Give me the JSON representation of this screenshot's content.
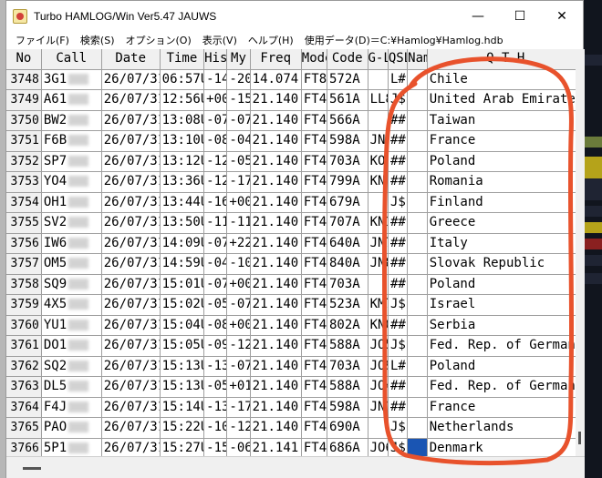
{
  "window": {
    "title": "Turbo HAMLOG/Win Ver5.47 JAUWS",
    "minimize_glyph": "—",
    "maximize_glyph": "☐",
    "close_glyph": "✕"
  },
  "menu": [
    "ファイル(F)",
    "検索(S)",
    "オプション(O)",
    "表示(V)",
    "ヘルプ(H)",
    "使用データ(D)＝C:¥Hamlog¥Hamlog.hdb"
  ],
  "columns": [
    "No",
    "Call",
    "Date",
    "Time",
    "His",
    "My",
    "Freq",
    "Mode",
    "Code",
    "G-L",
    "QSL",
    "Nam",
    "Q T H"
  ],
  "rows": [
    {
      "no": "3748",
      "call": "3G1",
      "date": "26/07/31",
      "time": "06:57U",
      "his": "-14",
      "my": "-20",
      "freq": "14.074",
      "mode": "FT8",
      "code": "572A",
      "gl": "",
      "qsl": "L#",
      "qth": "Chile"
    },
    {
      "no": "3749",
      "call": "A61",
      "date": "26/07/31",
      "time": "12:56U",
      "his": "+00",
      "my": "-15",
      "freq": "21.140",
      "mode": "FT4",
      "code": "561A",
      "gl": "LL8",
      "qsl": "J$",
      "qth": "United Arab Emirates"
    },
    {
      "no": "3750",
      "call": "BW2",
      "date": "26/07/31",
      "time": "13:08U",
      "his": "-07",
      "my": "-07",
      "freq": "21.140",
      "mode": "FT4",
      "code": "566A",
      "gl": "",
      "qsl": "##",
      "qth": "Taiwan"
    },
    {
      "no": "3751",
      "call": "F6B",
      "date": "26/07/31",
      "time": "13:10U",
      "his": "-08",
      "my": "-04",
      "freq": "21.140",
      "mode": "FT4",
      "code": "598A",
      "gl": "JN1",
      "qsl": "##",
      "qth": "France"
    },
    {
      "no": "3752",
      "call": "SP7",
      "date": "26/07/31",
      "time": "13:12U",
      "his": "-12",
      "my": "-05",
      "freq": "21.140",
      "mode": "FT4",
      "code": "703A",
      "gl": "KO0",
      "qsl": "##",
      "qth": "Poland"
    },
    {
      "no": "3753",
      "call": "YO4",
      "date": "26/07/31",
      "time": "13:36U",
      "his": "-12",
      "my": "-17",
      "freq": "21.140",
      "mode": "FT4",
      "code": "799A",
      "gl": "KN4",
      "qsl": "##",
      "qth": "Romania"
    },
    {
      "no": "3754",
      "call": "OH1",
      "date": "26/07/31",
      "time": "13:44U",
      "his": "-16",
      "my": "+00",
      "freq": "21.140",
      "mode": "FT4",
      "code": "679A",
      "gl": "",
      "qsl": "J$",
      "qth": "Finland"
    },
    {
      "no": "3755",
      "call": "SV2",
      "date": "26/07/31",
      "time": "13:50U",
      "his": "-11",
      "my": "-11",
      "freq": "21.140",
      "mode": "FT4",
      "code": "707A",
      "gl": "KN1",
      "qsl": "##",
      "qth": "Greece"
    },
    {
      "no": "3756",
      "call": "IW6",
      "date": "26/07/31",
      "time": "14:09U",
      "his": "-07",
      "my": "+22",
      "freq": "21.140",
      "mode": "FT4",
      "code": "640A",
      "gl": "JN7",
      "qsl": "##",
      "qth": "Italy"
    },
    {
      "no": "3757",
      "call": "OM5",
      "date": "26/07/31",
      "time": "14:59U",
      "his": "-04",
      "my": "-10",
      "freq": "21.140",
      "mode": "FT4",
      "code": "840A",
      "gl": "JN8",
      "qsl": "##",
      "qth": "Slovak Republic"
    },
    {
      "no": "3758",
      "call": "SQ9",
      "date": "26/07/31",
      "time": "15:01U",
      "his": "-07",
      "my": "+00",
      "freq": "21.140",
      "mode": "FT4",
      "code": "703A",
      "gl": "",
      "qsl": "##",
      "qth": "Poland"
    },
    {
      "no": "3759",
      "call": "4X5",
      "date": "26/07/31",
      "time": "15:02U",
      "his": "-05",
      "my": "-07",
      "freq": "21.140",
      "mode": "FT4",
      "code": "523A",
      "gl": "KM7",
      "qsl": "J$",
      "qth": "Israel"
    },
    {
      "no": "3760",
      "call": "YU1",
      "date": "26/07/31",
      "time": "15:04U",
      "his": "-08",
      "my": "+00",
      "freq": "21.140",
      "mode": "FT4",
      "code": "802A",
      "gl": "KN0",
      "qsl": "##",
      "qth": "Serbia"
    },
    {
      "no": "3761",
      "call": "DO1",
      "date": "26/07/31",
      "time": "15:05U",
      "his": "-09",
      "my": "-12",
      "freq": "21.140",
      "mode": "FT4",
      "code": "588A",
      "gl": "JO5",
      "qsl": "J$",
      "qth": "Fed. Rep. of Germany"
    },
    {
      "no": "3762",
      "call": "SQ2",
      "date": "26/07/31",
      "time": "15:13U",
      "his": "-13",
      "my": "-07",
      "freq": "21.140",
      "mode": "FT4",
      "code": "703A",
      "gl": "JO9",
      "qsl": "L#",
      "qth": "Poland"
    },
    {
      "no": "3763",
      "call": "DL5",
      "date": "26/07/31",
      "time": "15:13U",
      "his": "-05",
      "my": "+01",
      "freq": "21.140",
      "mode": "FT4",
      "code": "588A",
      "gl": "JO4",
      "qsl": "##",
      "qth": "Fed. Rep. of Germany"
    },
    {
      "no": "3764",
      "call": "F4J",
      "date": "26/07/31",
      "time": "15:14U",
      "his": "-13",
      "my": "-17",
      "freq": "21.140",
      "mode": "FT4",
      "code": "598A",
      "gl": "JN1",
      "qsl": "##",
      "qth": "France"
    },
    {
      "no": "3765",
      "call": "PAO",
      "date": "26/07/31",
      "time": "15:22U",
      "his": "-10",
      "my": "-12",
      "freq": "21.140",
      "mode": "FT4",
      "code": "690A",
      "gl": "",
      "qsl": "J$",
      "qth": "Netherlands"
    },
    {
      "no": "3766",
      "call": "5P1",
      "date": "26/07/31",
      "time": "15:27U",
      "his": "-15",
      "my": "-06",
      "freq": "21.141",
      "mode": "FT4",
      "code": "686A",
      "gl": "JO6",
      "qsl": "J$",
      "qth": "Denmark"
    }
  ],
  "colors": {
    "highlight": "#e8522c",
    "selected_cell": "#1a55b3"
  }
}
